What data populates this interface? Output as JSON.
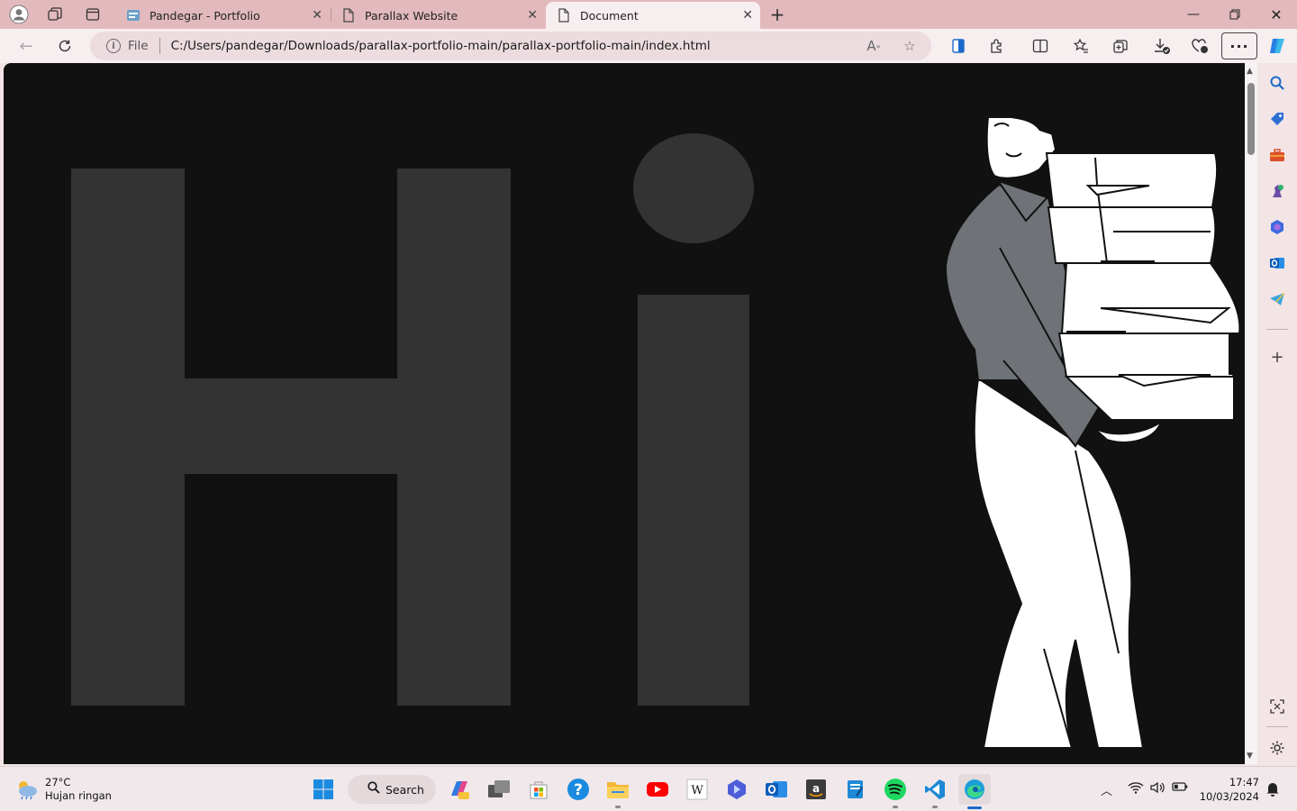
{
  "browser": {
    "tabs": [
      {
        "title": "Pandegar - Portfolio",
        "active": false
      },
      {
        "title": "Parallax Website",
        "active": false
      },
      {
        "title": "Document",
        "active": true
      }
    ],
    "address": {
      "scheme_label": "File",
      "url": "C:/Users/pandegar/Downloads/parallax-portfolio-main/parallax-portfolio-main/index.html"
    },
    "more_label": "···"
  },
  "page": {
    "headline": "Hi",
    "background_color": "#111111",
    "text_color": "#333333"
  },
  "taskbar": {
    "weather": {
      "temp": "27°C",
      "desc": "Hujan ringan"
    },
    "search_label": "Search",
    "clock": {
      "time": "17:47",
      "date": "10/03/2024"
    }
  },
  "icons": {
    "tab_icons": [
      "site-favicon-icon",
      "document-icon",
      "document-icon"
    ],
    "sidebar": [
      "search-icon",
      "tag-icon",
      "toolbox-icon",
      "chess-icon",
      "copilot-icon",
      "outlook-icon",
      "telegram-icon",
      "add-icon",
      "screenshot-icon",
      "settings-icon"
    ],
    "taskbar_apps": [
      "windows-start-icon",
      "copilot-app-icon",
      "task-view-icon",
      "store-icon",
      "help-icon",
      "file-explorer-icon",
      "youtube-icon",
      "wikipedia-icon",
      "bing-icon",
      "outlook-icon",
      "amazon-icon",
      "notepad-icon",
      "spotify-icon",
      "vscode-icon",
      "edge-icon"
    ]
  }
}
